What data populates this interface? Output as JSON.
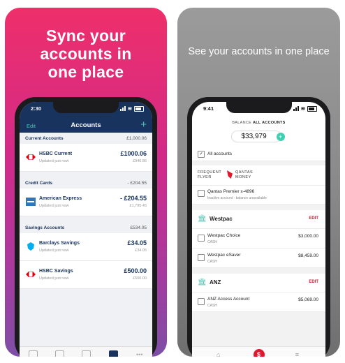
{
  "left_panel": {
    "headline_lines": [
      "Sync your",
      "accounts in",
      "one place"
    ],
    "phone": {
      "time": "2:30",
      "edit": "Edit",
      "title": "Accounts",
      "add": "+",
      "sections": [
        {
          "title": "Current Accounts",
          "total": "£1,000.06",
          "accounts": [
            {
              "name": "HSBC Current",
              "updated": "Updated just now",
              "balance": "£1000.06",
              "sub": "£940.86",
              "logo": "hsbc-logo-icon"
            }
          ]
        },
        {
          "title": "Credit Cards",
          "total": "- £204.55",
          "accounts": [
            {
              "name": "American Express",
              "updated": "Updated just now",
              "balance": "- £204.55",
              "sub": "£1,795.45",
              "logo": "amex-logo-icon"
            }
          ]
        },
        {
          "title": "Savings Accounts",
          "total": "£534.05",
          "accounts": [
            {
              "name": "Barclays Savings",
              "updated": "Updated just now",
              "balance": "£34.05",
              "sub": "£34.05",
              "logo": "barclays-logo-icon"
            },
            {
              "name": "HSBC Savings",
              "updated": "Updated just now",
              "balance": "£500.00",
              "sub": "£500.00",
              "logo": "hsbc-logo-icon"
            }
          ]
        }
      ],
      "tabs": [
        "grid-icon",
        "rocket-icon",
        "transfer-icon",
        "wallet-icon",
        "more-icon"
      ]
    }
  },
  "right_panel": {
    "headline": "See your accounts in one place",
    "phone": {
      "time": "9:41",
      "balance_label_prefix": "BALANCE",
      "balance_label_bold": "ALL ACCOUNTS",
      "balance": "$33,979",
      "all_accounts": "All accounts",
      "frequent_flyer": {
        "line1": "FREQUENT",
        "line2": "FLYER",
        "qantas1": "QANTAS",
        "qantas2": "MONEY"
      },
      "qantas_account": {
        "name": "Qantas Premier x-4896",
        "status": "Inactive account - balance unavailable"
      },
      "banks": [
        {
          "name": "Westpac",
          "edit": "EDIT",
          "accounts": [
            {
              "name": "Westpac Choice",
              "type": "CASH",
              "amount": "$3,000.00"
            },
            {
              "name": "Westpac eSaver",
              "type": "CASH",
              "amount": "$8,459.00"
            }
          ]
        },
        {
          "name": "ANZ",
          "edit": "EDIT",
          "accounts": [
            {
              "name": "ANZ Access Account",
              "type": "CASH",
              "amount": "$5,069.00"
            }
          ]
        }
      ],
      "tabs": [
        "home-icon",
        "dollar-icon",
        "menu-icon"
      ]
    }
  },
  "colors": {
    "navy": "#17335e",
    "teal": "#4fc3b3",
    "red": "#e0182d",
    "pink": "#ee2f6a"
  }
}
